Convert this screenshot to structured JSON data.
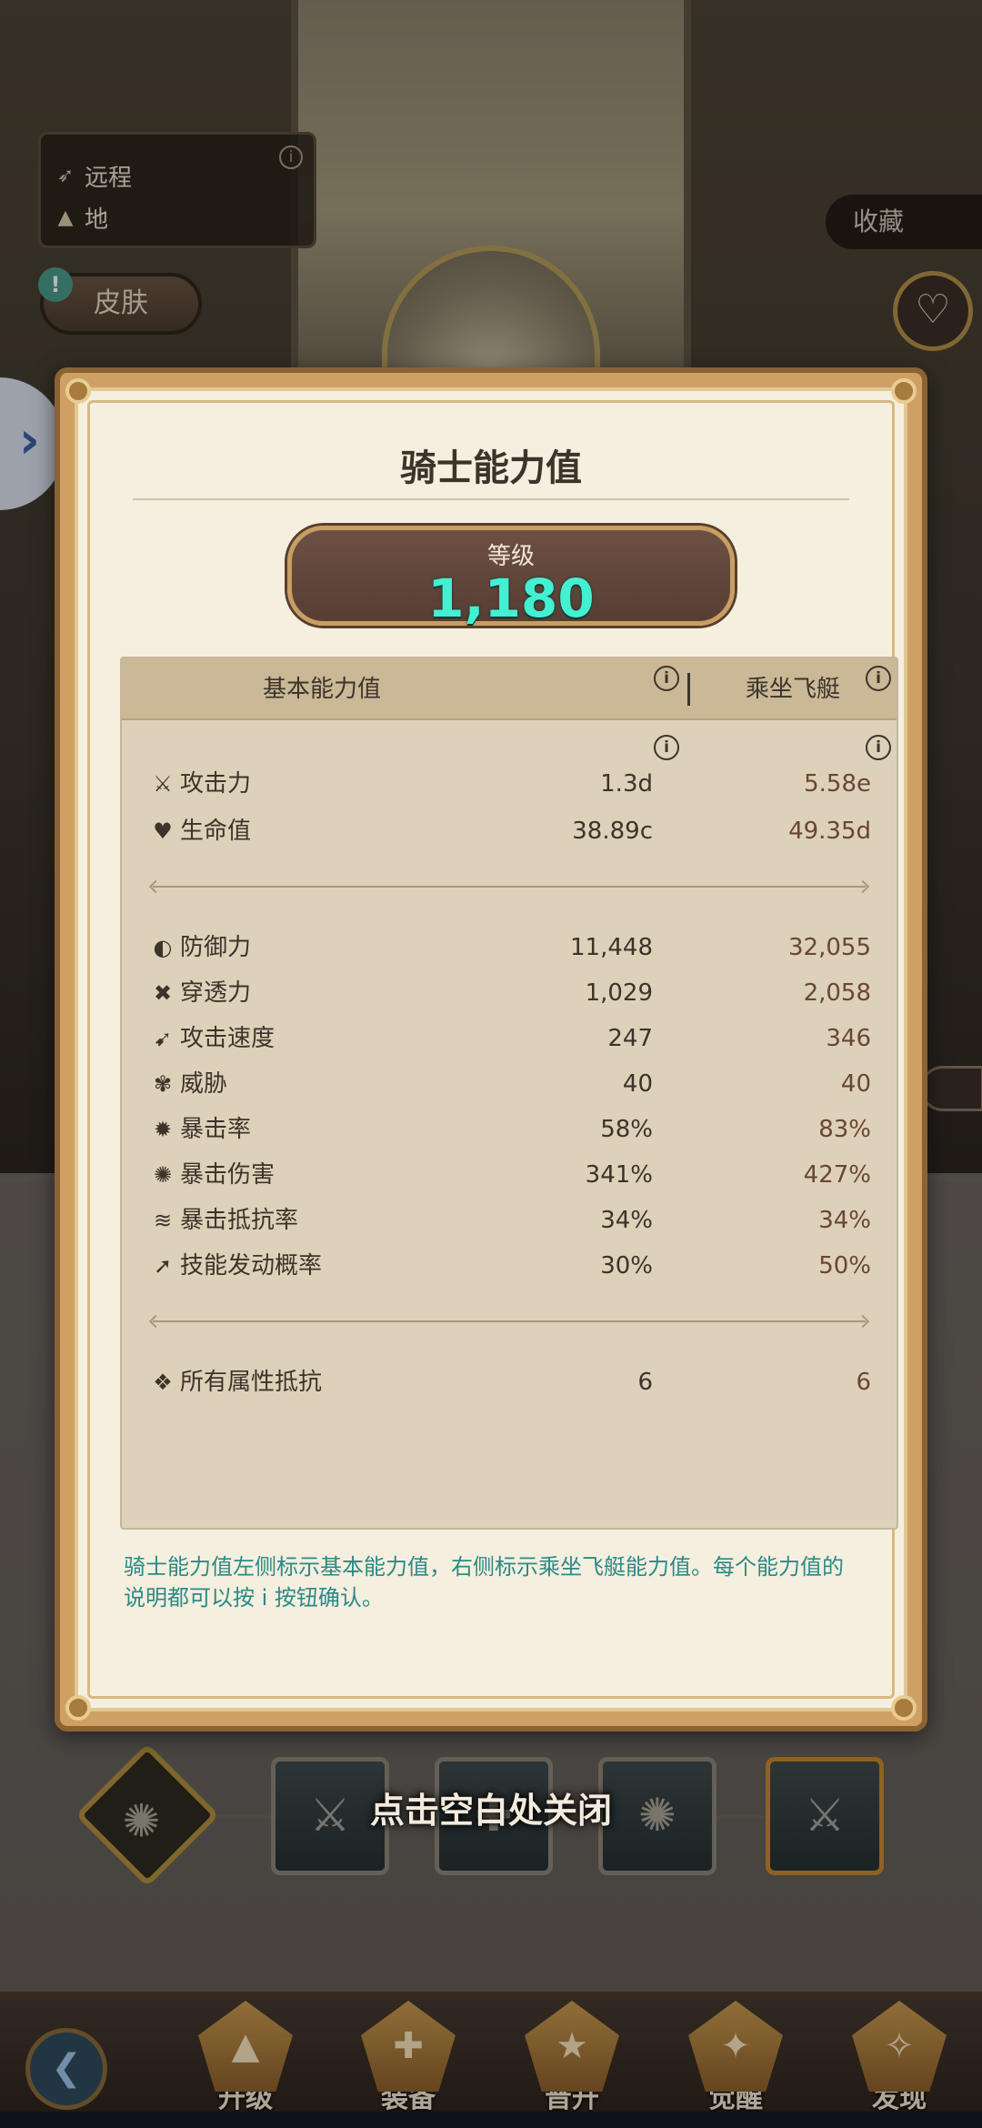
{
  "background": {
    "info_card": {
      "rows": [
        {
          "icon": "bow-icon",
          "glyph": "➶",
          "label": "远程"
        },
        {
          "icon": "ground-icon",
          "glyph": "▲",
          "label": "地"
        }
      ],
      "info_glyph": "i"
    },
    "skin_button": "皮肤",
    "skin_badge": "!",
    "favorite_button": "收藏",
    "heart_glyph": "♡",
    "side_arrow_glyph": "›",
    "close_hint": "点击空白处关闭"
  },
  "bottom_nav": {
    "back_glyph": "❮",
    "items": [
      {
        "label": "升级",
        "glyph": "▲"
      },
      {
        "label": "装备",
        "glyph": "✚"
      },
      {
        "label": "晋升",
        "glyph": "★"
      },
      {
        "label": "觉醒",
        "glyph": "✦"
      },
      {
        "label": "发现",
        "glyph": "✧"
      }
    ]
  },
  "modal": {
    "title": "骑士能力值",
    "level_label": "等级",
    "level_value": "1,180",
    "header": {
      "base": "基本能力值",
      "mount": "乘坐飞艇",
      "info_glyph": "i"
    },
    "stats": [
      {
        "icon": "sword-icon",
        "glyph": "⚔",
        "name": "攻击力",
        "base": "1.3d",
        "mount": "5.58e"
      },
      {
        "icon": "heart-plus-icon",
        "glyph": "♥",
        "name": "生命值",
        "base": "38.89c",
        "mount": "49.35d"
      },
      {
        "icon": "shield-half-icon",
        "glyph": "◐",
        "name": "防御力",
        "base": "11,448",
        "mount": "32,055"
      },
      {
        "icon": "pierce-icon",
        "glyph": "✖",
        "name": "穿透力",
        "base": "1,029",
        "mount": "2,058"
      },
      {
        "icon": "attack-speed-icon",
        "glyph": "➹",
        "name": "攻击速度",
        "base": "247",
        "mount": "346"
      },
      {
        "icon": "threat-icon",
        "glyph": "✾",
        "name": "威胁",
        "base": "40",
        "mount": "40"
      },
      {
        "icon": "crit-rate-icon",
        "glyph": "✹",
        "name": "暴击率",
        "base": "58%",
        "mount": "83%"
      },
      {
        "icon": "crit-damage-icon",
        "glyph": "✺",
        "name": "暴击伤害",
        "base": "341%",
        "mount": "427%"
      },
      {
        "icon": "crit-resist-icon",
        "glyph": "≋",
        "name": "暴击抵抗率",
        "base": "34%",
        "mount": "34%"
      },
      {
        "icon": "skill-proc-icon",
        "glyph": "➚",
        "name": "技能发动概率",
        "base": "30%",
        "mount": "50%"
      },
      {
        "icon": "element-resist-icon",
        "glyph": "❖",
        "name": "所有属性抵抗",
        "base": "6",
        "mount": "6"
      }
    ],
    "note": "骑士能力值左侧标示基本能力值，右侧标示乘坐飞艇能力值。每个能力值的说明都可以按 i 按钮确认。"
  },
  "colors": {
    "level_value": "#45f0d2",
    "note_text": "#2c8a84",
    "mount_value": "#6a4536",
    "frame_gold": "#cfa064"
  }
}
